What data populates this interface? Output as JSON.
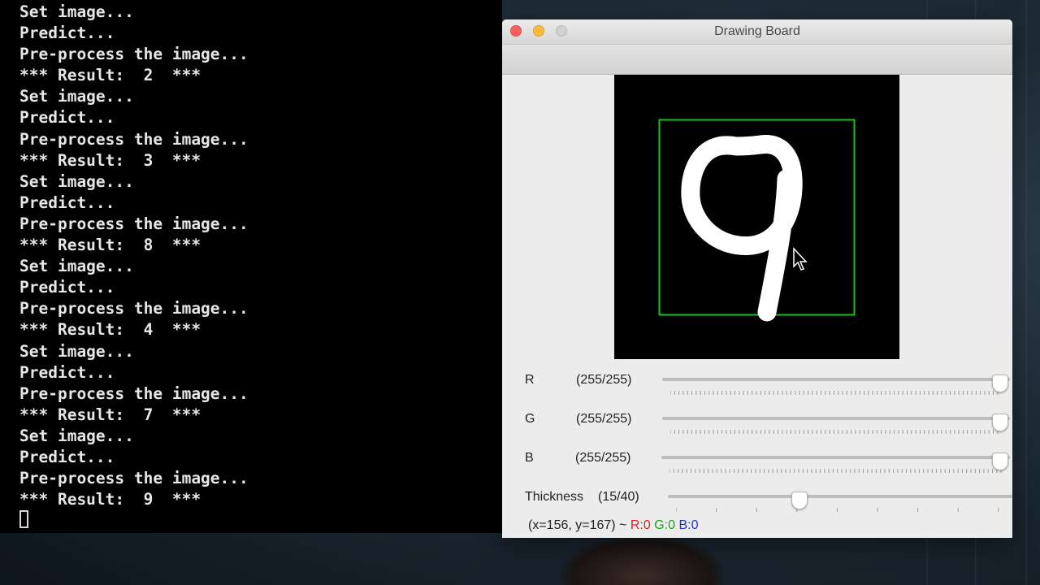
{
  "terminal": {
    "lines": [
      "Set image...",
      "Predict...",
      "Pre-process the image...",
      "*** Result:  2  ***",
      "Set image...",
      "Predict...",
      "Pre-process the image...",
      "*** Result:  3  ***",
      "Set image...",
      "Predict...",
      "Pre-process the image...",
      "*** Result:  8  ***",
      "Set image...",
      "Predict...",
      "Pre-process the image...",
      "*** Result:  4  ***",
      "Set image...",
      "Predict...",
      "Pre-process the image...",
      "*** Result:  7  ***",
      "Set image...",
      "Predict...",
      "Pre-process the image...",
      "*** Result:  9  ***"
    ]
  },
  "window": {
    "title": "Drawing Board"
  },
  "sliders": {
    "r": {
      "label": "R",
      "value_text": "(255/255)",
      "value": 255,
      "max": 255
    },
    "g": {
      "label": "G",
      "value_text": "(255/255)",
      "value": 255,
      "max": 255
    },
    "b": {
      "label": "B",
      "value_text": "(255/255)",
      "value": 255,
      "max": 255
    },
    "thickness": {
      "label": "Thickness",
      "value_text": "(15/40)",
      "value": 15,
      "max": 40
    }
  },
  "status": {
    "coords": "(x=156, y=167) ~ ",
    "r": "R:0",
    "g": "G:0",
    "b": "B:0"
  },
  "colors": {
    "stroke": "#ffffff",
    "bounding_box": "#19c219",
    "status_r": "#e02020",
    "status_g": "#1da01d",
    "status_b": "#2233cc"
  }
}
